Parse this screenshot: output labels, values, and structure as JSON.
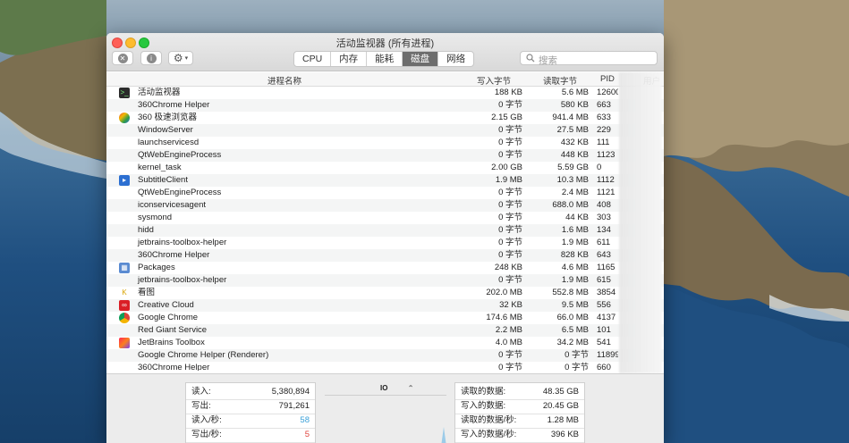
{
  "window": {
    "title": "活动监视器 (所有进程)"
  },
  "toolbar": {
    "tabs": [
      "CPU",
      "内存",
      "能耗",
      "磁盘",
      "网络"
    ],
    "active_tab": "磁盘",
    "search_placeholder": "搜索"
  },
  "columns": {
    "name": "进程名称",
    "written": "写入字节",
    "read": "读取字节",
    "pid": "PID",
    "user": "用户"
  },
  "processes": [
    {
      "name": "活动监视器",
      "written": "188 KB",
      "read": "5.6 MB",
      "pid": "12600",
      "icon": "terminal-icon"
    },
    {
      "name": "360Chrome Helper",
      "written": "0 字节",
      "read": "580 KB",
      "pid": "663",
      "icon": ""
    },
    {
      "name": "360 极速浏览器",
      "written": "2.15 GB",
      "read": "941.4 MB",
      "pid": "633",
      "icon": "browser-360-icon"
    },
    {
      "name": "WindowServer",
      "written": "0 字节",
      "read": "27.5 MB",
      "pid": "229",
      "icon": ""
    },
    {
      "name": "launchservicesd",
      "written": "0 字节",
      "read": "432 KB",
      "pid": "111",
      "icon": ""
    },
    {
      "name": "QtWebEngineProcess",
      "written": "0 字节",
      "read": "448 KB",
      "pid": "1123",
      "icon": ""
    },
    {
      "name": "kernel_task",
      "written": "2.00 GB",
      "read": "5.59 GB",
      "pid": "0",
      "icon": ""
    },
    {
      "name": "SubtitleClient",
      "written": "1.9 MB",
      "read": "10.3 MB",
      "pid": "1112",
      "icon": "subtitle-icon"
    },
    {
      "name": "QtWebEngineProcess",
      "written": "0 字节",
      "read": "2.4 MB",
      "pid": "1121",
      "icon": ""
    },
    {
      "name": "iconservicesagent",
      "written": "0 字节",
      "read": "688.0 MB",
      "pid": "408",
      "icon": ""
    },
    {
      "name": "sysmond",
      "written": "0 字节",
      "read": "44 KB",
      "pid": "303",
      "icon": ""
    },
    {
      "name": "hidd",
      "written": "0 字节",
      "read": "1.6 MB",
      "pid": "134",
      "icon": ""
    },
    {
      "name": "jetbrains-toolbox-helper",
      "written": "0 字节",
      "read": "1.9 MB",
      "pid": "611",
      "icon": ""
    },
    {
      "name": "360Chrome Helper",
      "written": "0 字节",
      "read": "828 KB",
      "pid": "643",
      "icon": ""
    },
    {
      "name": "Packages",
      "written": "248 KB",
      "read": "4.6 MB",
      "pid": "1165",
      "icon": "packages-icon"
    },
    {
      "name": "jetbrains-toolbox-helper",
      "written": "0 字节",
      "read": "1.9 MB",
      "pid": "615",
      "icon": ""
    },
    {
      "name": "看图",
      "written": "202.0 MB",
      "read": "552.8 MB",
      "pid": "3854",
      "icon": "viewer-k-icon"
    },
    {
      "name": "Creative Cloud",
      "written": "32 KB",
      "read": "9.5 MB",
      "pid": "556",
      "icon": "creative-cloud-icon"
    },
    {
      "name": "Google Chrome",
      "written": "174.6 MB",
      "read": "66.0 MB",
      "pid": "4137",
      "icon": "chrome-icon"
    },
    {
      "name": "Red Giant Service",
      "written": "2.2 MB",
      "read": "6.5 MB",
      "pid": "101",
      "icon": ""
    },
    {
      "name": "JetBrains Toolbox",
      "written": "4.0 MB",
      "read": "34.2 MB",
      "pid": "541",
      "icon": "jetbrains-icon"
    },
    {
      "name": "Google Chrome Helper (Renderer)",
      "written": "0 字节",
      "read": "0 字节",
      "pid": "11899",
      "icon": ""
    },
    {
      "name": "360Chrome Helper",
      "written": "0 字节",
      "read": "0 字节",
      "pid": "660",
      "icon": ""
    }
  ],
  "summary": {
    "left": [
      {
        "label": "读入:",
        "value": "5,380,894",
        "color": "#222222"
      },
      {
        "label": "写出:",
        "value": "791,261",
        "color": "#222222"
      },
      {
        "label": "读入/秒:",
        "value": "58",
        "color": "#3aa0d8"
      },
      {
        "label": "写出/秒:",
        "value": "5",
        "color": "#e0443e"
      }
    ],
    "graph_selector": "IO",
    "right": [
      {
        "label": "读取的数据:",
        "value": "48.35 GB"
      },
      {
        "label": "写入的数据:",
        "value": "20.45 GB"
      },
      {
        "label": "读取的数据/秒:",
        "value": "1.28 MB"
      },
      {
        "label": "写入的数据/秒:",
        "value": "396 KB"
      }
    ]
  }
}
